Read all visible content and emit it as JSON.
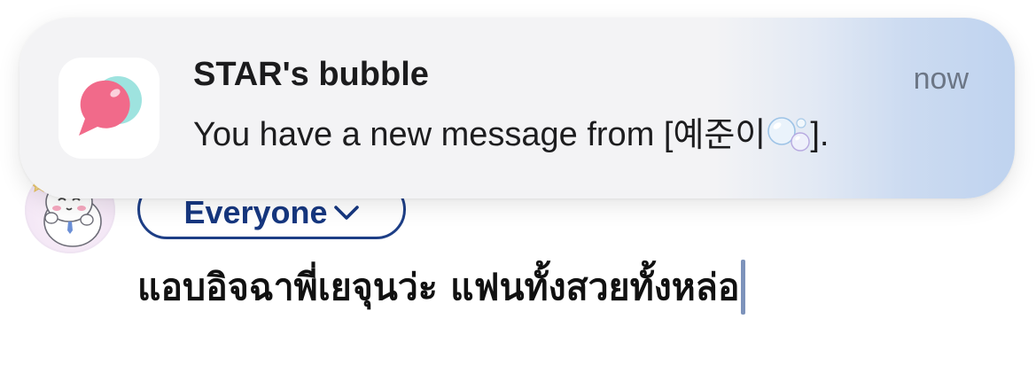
{
  "notification": {
    "app_name": "STAR's bubble",
    "time": "now",
    "message_prefix": "You have a new message from [",
    "sender": "예준이",
    "message_suffix": "].",
    "emoji": "bubbles-emoji"
  },
  "composer": {
    "audience": "Everyone",
    "post_text": "แอบอิจฉาพี่เยจุนว่ะ แฟนทั้งสวยทั้งหล่อ"
  },
  "colors": {
    "audience_accent": "#1d3e86",
    "app_icon_bubble_pink": "#f16a8a",
    "app_icon_bubble_teal": "#9ee3df",
    "banner_gradient_end": "#bfd3ef",
    "caret": "#7d93bb"
  }
}
